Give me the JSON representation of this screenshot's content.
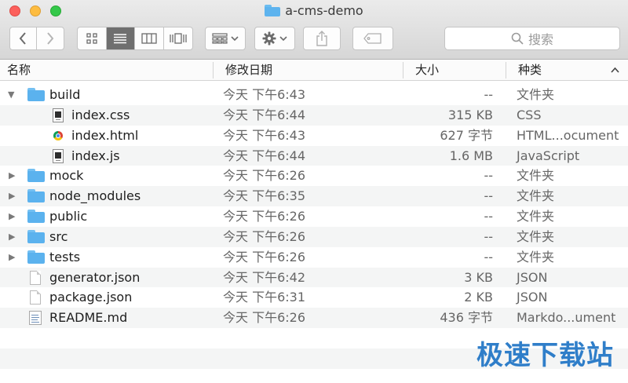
{
  "window": {
    "title": "a-cms-demo"
  },
  "toolbar": {
    "back_icon": "chevron-left-icon",
    "forward_icon": "chevron-right-icon",
    "view_modes": [
      "icon-view-icon",
      "list-view-icon",
      "column-view-icon",
      "cover-flow-icon"
    ],
    "active_view": "list-view-icon",
    "search_placeholder": "搜索"
  },
  "columns": {
    "name": "名称",
    "date": "修改日期",
    "size": "大小",
    "kind": "种类"
  },
  "rows": [
    {
      "name": "build",
      "date": "今天 下午6:43",
      "size": "--",
      "kind": "文件夹",
      "type": "folder",
      "level": 0,
      "expanded": true
    },
    {
      "name": "index.css",
      "date": "今天 下午6:44",
      "size": "315 KB",
      "kind": "CSS",
      "type": "css",
      "level": 1
    },
    {
      "name": "index.html",
      "date": "今天 下午6:43",
      "size": "627 字节",
      "kind": "HTML...ocument",
      "type": "html",
      "level": 1
    },
    {
      "name": "index.js",
      "date": "今天 下午6:44",
      "size": "1.6 MB",
      "kind": "JavaScript",
      "type": "js",
      "level": 1
    },
    {
      "name": "mock",
      "date": "今天 下午6:26",
      "size": "--",
      "kind": "文件夹",
      "type": "folder",
      "level": 0,
      "expanded": false
    },
    {
      "name": "node_modules",
      "date": "今天 下午6:35",
      "size": "--",
      "kind": "文件夹",
      "type": "folder",
      "level": 0,
      "expanded": false
    },
    {
      "name": "public",
      "date": "今天 下午6:26",
      "size": "--",
      "kind": "文件夹",
      "type": "folder",
      "level": 0,
      "expanded": false
    },
    {
      "name": "src",
      "date": "今天 下午6:26",
      "size": "--",
      "kind": "文件夹",
      "type": "folder",
      "level": 0,
      "expanded": false
    },
    {
      "name": "tests",
      "date": "今天 下午6:26",
      "size": "--",
      "kind": "文件夹",
      "type": "folder",
      "level": 0,
      "expanded": false
    },
    {
      "name": "generator.json",
      "date": "今天 下午6:42",
      "size": "3 KB",
      "kind": "JSON",
      "type": "json",
      "level": 0
    },
    {
      "name": "package.json",
      "date": "今天 下午6:31",
      "size": "2 KB",
      "kind": "JSON",
      "type": "json",
      "level": 0
    },
    {
      "name": "README.md",
      "date": "今天 下午6:26",
      "size": "436 字节",
      "kind": "Markdo...ument",
      "type": "md",
      "level": 0
    }
  ],
  "watermark": "极速下载站"
}
